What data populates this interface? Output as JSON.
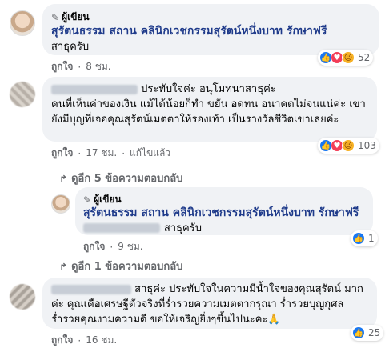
{
  "comment1": {
    "author": "ผู้เขียน",
    "text": "สุรัตนธรรม สถาน คลินิกเวชกรรมสุรัตน์หนึ่งบาท รักษาฟรี",
    "text2": "สาธุครับ",
    "like": "ถูกใจ",
    "time": "8 ชม.",
    "reaction_count": "52"
  },
  "comment2": {
    "text": "ประทับใจค่ะ อนุโมทนาสาธุค่ะ\nคนที่เห็นค่าของเงิน แม้ได้น้อยก็ทำ ขยัน อดทน อนาคตไม่จนแน่ค่ะ เขายังมีบุญที่เจอคุณสุรัตน์เมตตาให้รองเท้า เป็นรางวัลชีวิตเขาเลยค่ะ",
    "like": "ถูกใจ",
    "time": "17 ชม.",
    "edited": "แก้ไขแล้ว",
    "reaction_count": "103"
  },
  "replies1": "ดูอีก 5 ข้อความตอบกลับ",
  "reply": {
    "author": "ผู้เขียน",
    "text": "สุรัตนธรรม สถาน คลินิกเวชกรรมสุรัตน์หนึ่งบาท รักษาฟรี",
    "suffix": "สาธุครับ",
    "like": "ถูกใจ",
    "time": "9 ชม.",
    "reaction_count": "1"
  },
  "replies2": "ดูอีก 1 ข้อความตอบกลับ",
  "comment3": {
    "text_after_name": "สาธุค่ะ ประทับใจในความมีน้ำใจของคุณสุรัตน์",
    "text_rest": "มากค่ะ คุณเคือเศรษฐีตัวจริงที่ร่ำรวยความเมตตากรุณา ร่ำรวยบุญกุศล ร่ำรวยคุณงามความดี ขอให้เจริญยิ่งๆขึ้นไปนะคะ🙏",
    "like": "ถูกใจ",
    "time": "16 ชม.",
    "reaction_count": "25"
  },
  "icons": {
    "pen": "pen-icon",
    "reply_arrow": "reply-arrow-icon",
    "like": "like-reaction-icon",
    "love": "love-reaction-icon",
    "care": "care-reaction-icon"
  },
  "colors": {
    "bubble": "#f0f2f5",
    "link_blue": "#1e3a8a",
    "meta_gray": "#65676b",
    "like_blue": "#1877f2",
    "love_red": "#f33e58"
  }
}
